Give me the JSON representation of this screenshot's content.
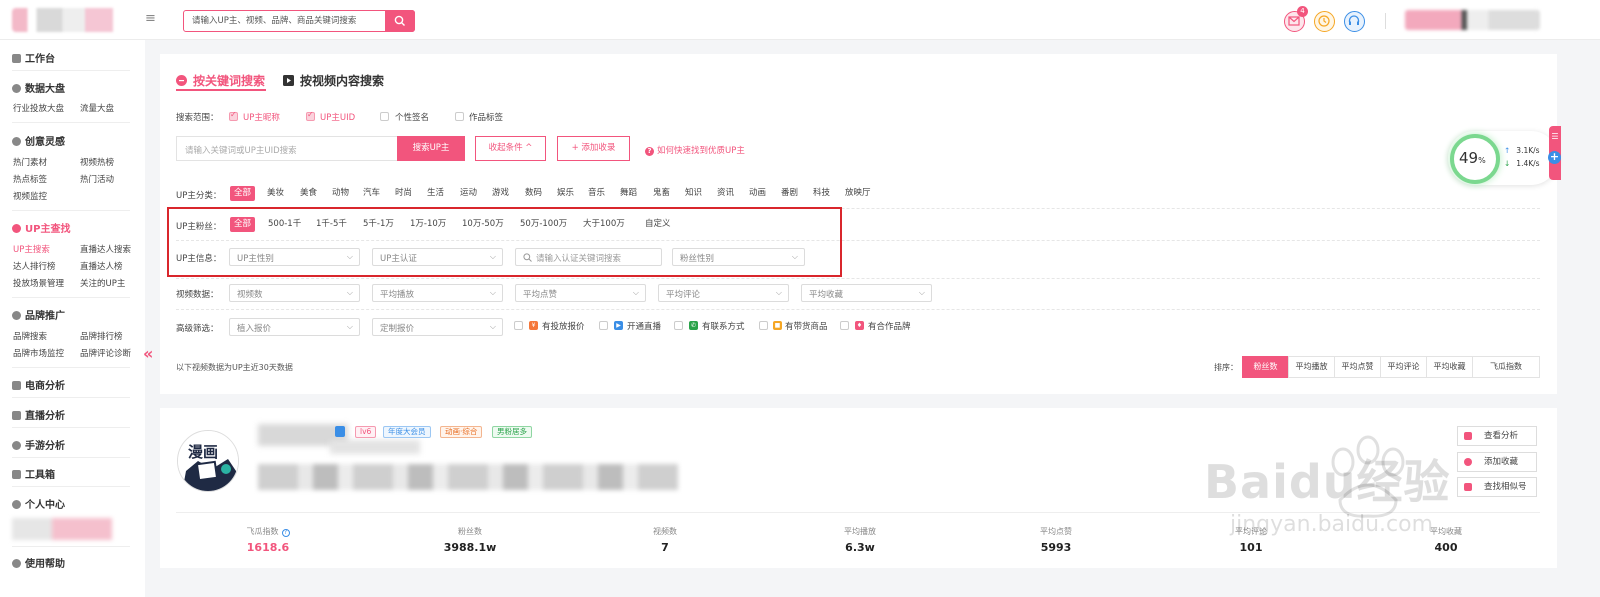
{
  "header": {
    "search_placeholder": "请输入UP主、视频、品牌、商品关键词搜索",
    "mail_badge": "4"
  },
  "sidebar": {
    "workbench": "工作台",
    "data_dashboard": "数据大盘",
    "industry_dashboard": "行业投放大盘",
    "traffic_dashboard": "流量大盘",
    "creative": "创意灵感",
    "hot_material": "热门素材",
    "video_hot": "视频热榜",
    "hot_tags": "热点标签",
    "hot_events": "热门活动",
    "video_monitor": "视频监控",
    "up_search_section": "UP主查找",
    "up_search": "UP主搜索",
    "live_search": "直播达人搜索",
    "talent_rank": "达人排行榜",
    "live_rank": "直播达人榜",
    "ad_plan": "投放场景管理",
    "followed_up": "关注的UP主",
    "brand_promo": "品牌推广",
    "brand_search": "品牌搜索",
    "brand_rank": "品牌排行榜",
    "brand_monitor": "品牌市场监控",
    "brand_comment": "品牌评论诊断",
    "ecommerce": "电商分析",
    "live_analysis": "直播分析",
    "game_analysis": "手游分析",
    "toolbox": "工具箱",
    "personal": "个人中心",
    "help": "使用帮助"
  },
  "tabs": {
    "keyword": "按关键词搜索",
    "video": "按视频内容搜索"
  },
  "scope": {
    "label": "搜索范围：",
    "options": [
      {
        "label": "UP主昵称",
        "checked": true
      },
      {
        "label": "UP主UID",
        "checked": true
      },
      {
        "label": "个性签名",
        "checked": false
      },
      {
        "label": "作品标签",
        "checked": false
      }
    ]
  },
  "keyword_search": {
    "placeholder": "请输入关键词或UP主UID搜索",
    "button": "搜索UP主",
    "collapse": "收起条件 ^",
    "add_favorite": "+ 添加收录",
    "help": "如何快速找到优质UP主"
  },
  "category": {
    "label": "UP主分类：",
    "items": [
      "全部",
      "美妆",
      "美食",
      "动物",
      "汽车",
      "时尚",
      "生活",
      "运动",
      "游戏",
      "数码",
      "娱乐",
      "音乐",
      "舞蹈",
      "鬼畜",
      "知识",
      "资讯",
      "动画",
      "番剧",
      "科技",
      "放映厅"
    ]
  },
  "fans": {
    "label": "UP主粉丝：",
    "items": [
      "全部",
      "500-1千",
      "1千-5千",
      "5千-1万",
      "1万-10万",
      "10万-50万",
      "50万-100万",
      "大于100万",
      "自定义"
    ]
  },
  "up_info": {
    "label": "UP主信息：",
    "gender": "UP主性别",
    "verify": "UP主认证",
    "verify_search": "请输入认证关键词搜索",
    "fan_gender": "粉丝性别"
  },
  "video_data": {
    "label": "视频数据：",
    "selects": [
      "视频数",
      "平均播放",
      "平均点赞",
      "平均评论",
      "平均收藏"
    ]
  },
  "advanced": {
    "label": "高级筛选：",
    "implant_price": "植入报价",
    "custom_price": "定制报价",
    "features": [
      "有投放报价",
      "开通直播",
      "有联系方式",
      "有带货商品",
      "有合作品牌"
    ]
  },
  "note": "以下视频数据为UP主近30天数据",
  "sort": {
    "label": "排序：",
    "items": [
      "粉丝数",
      "平均播放",
      "平均点赞",
      "平均评论",
      "平均收藏",
      "飞瓜指数"
    ]
  },
  "speed": {
    "percent": "49",
    "percent_sign": "%",
    "up": "3.1K/s",
    "down": "1.4K/s"
  },
  "result": {
    "avatar_text": "漫画",
    "badges": [
      "lv6",
      "年度大会员",
      "动画·综合",
      "男粉居多"
    ],
    "actions": [
      "查看分析",
      "添加收藏",
      "查找相似号"
    ],
    "stats": [
      {
        "label": "飞瓜指数",
        "value": "1618.6"
      },
      {
        "label": "粉丝数",
        "value": "3988.1w"
      },
      {
        "label": "视频数",
        "value": "7"
      },
      {
        "label": "平均播放",
        "value": "6.3w"
      },
      {
        "label": "平均点赞",
        "value": "5993"
      },
      {
        "label": "平均评论",
        "value": "101"
      },
      {
        "label": "平均收藏",
        "value": "400"
      }
    ]
  },
  "watermark": {
    "brand": "Baidu经验",
    "url": "jingyan.baidu.com"
  }
}
